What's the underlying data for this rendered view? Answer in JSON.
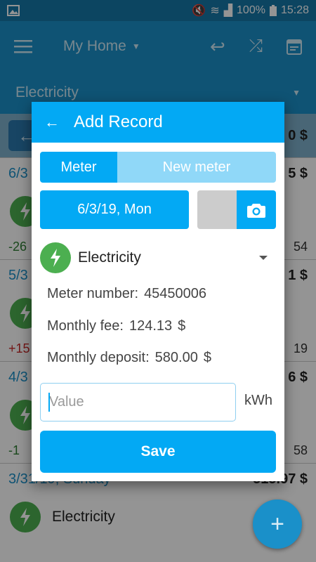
{
  "status_bar": {
    "battery": "100%",
    "time": "15:28"
  },
  "app_bar": {
    "title": "My Home",
    "category": "Electricity"
  },
  "background": {
    "nav_amount": "0 $",
    "days": [
      {
        "date": "6/3",
        "total": "5 $",
        "item": "",
        "left": "-26",
        "right": "54"
      },
      {
        "date": "5/3",
        "total": "1 $",
        "item": "",
        "left": "+15",
        "right": "19"
      },
      {
        "date": "4/3",
        "total": "6 $",
        "item": "",
        "left": "-1",
        "right": "58"
      },
      {
        "date": "3/31/19, Sunday",
        "total": "-515.97 $",
        "item": "Electricity",
        "left": "",
        "right": ""
      }
    ]
  },
  "dialog": {
    "title": "Add Record",
    "segments": {
      "meter": "Meter",
      "new_meter": "New meter"
    },
    "date": "6/3/19, Mon",
    "category": "Electricity",
    "meter_number": {
      "label": "Meter number:",
      "value": "45450006"
    },
    "monthly_fee": {
      "label": "Monthly fee:",
      "value": "124.13",
      "currency": "$"
    },
    "monthly_deposit": {
      "label": "Monthly deposit:",
      "value": "580.00",
      "currency": "$"
    },
    "value_placeholder": "Value",
    "unit": "kWh",
    "save_label": "Save"
  },
  "colors": {
    "primary": "#03a9f4",
    "app_bar": "#1a90c9",
    "category_green": "#4caf50"
  }
}
